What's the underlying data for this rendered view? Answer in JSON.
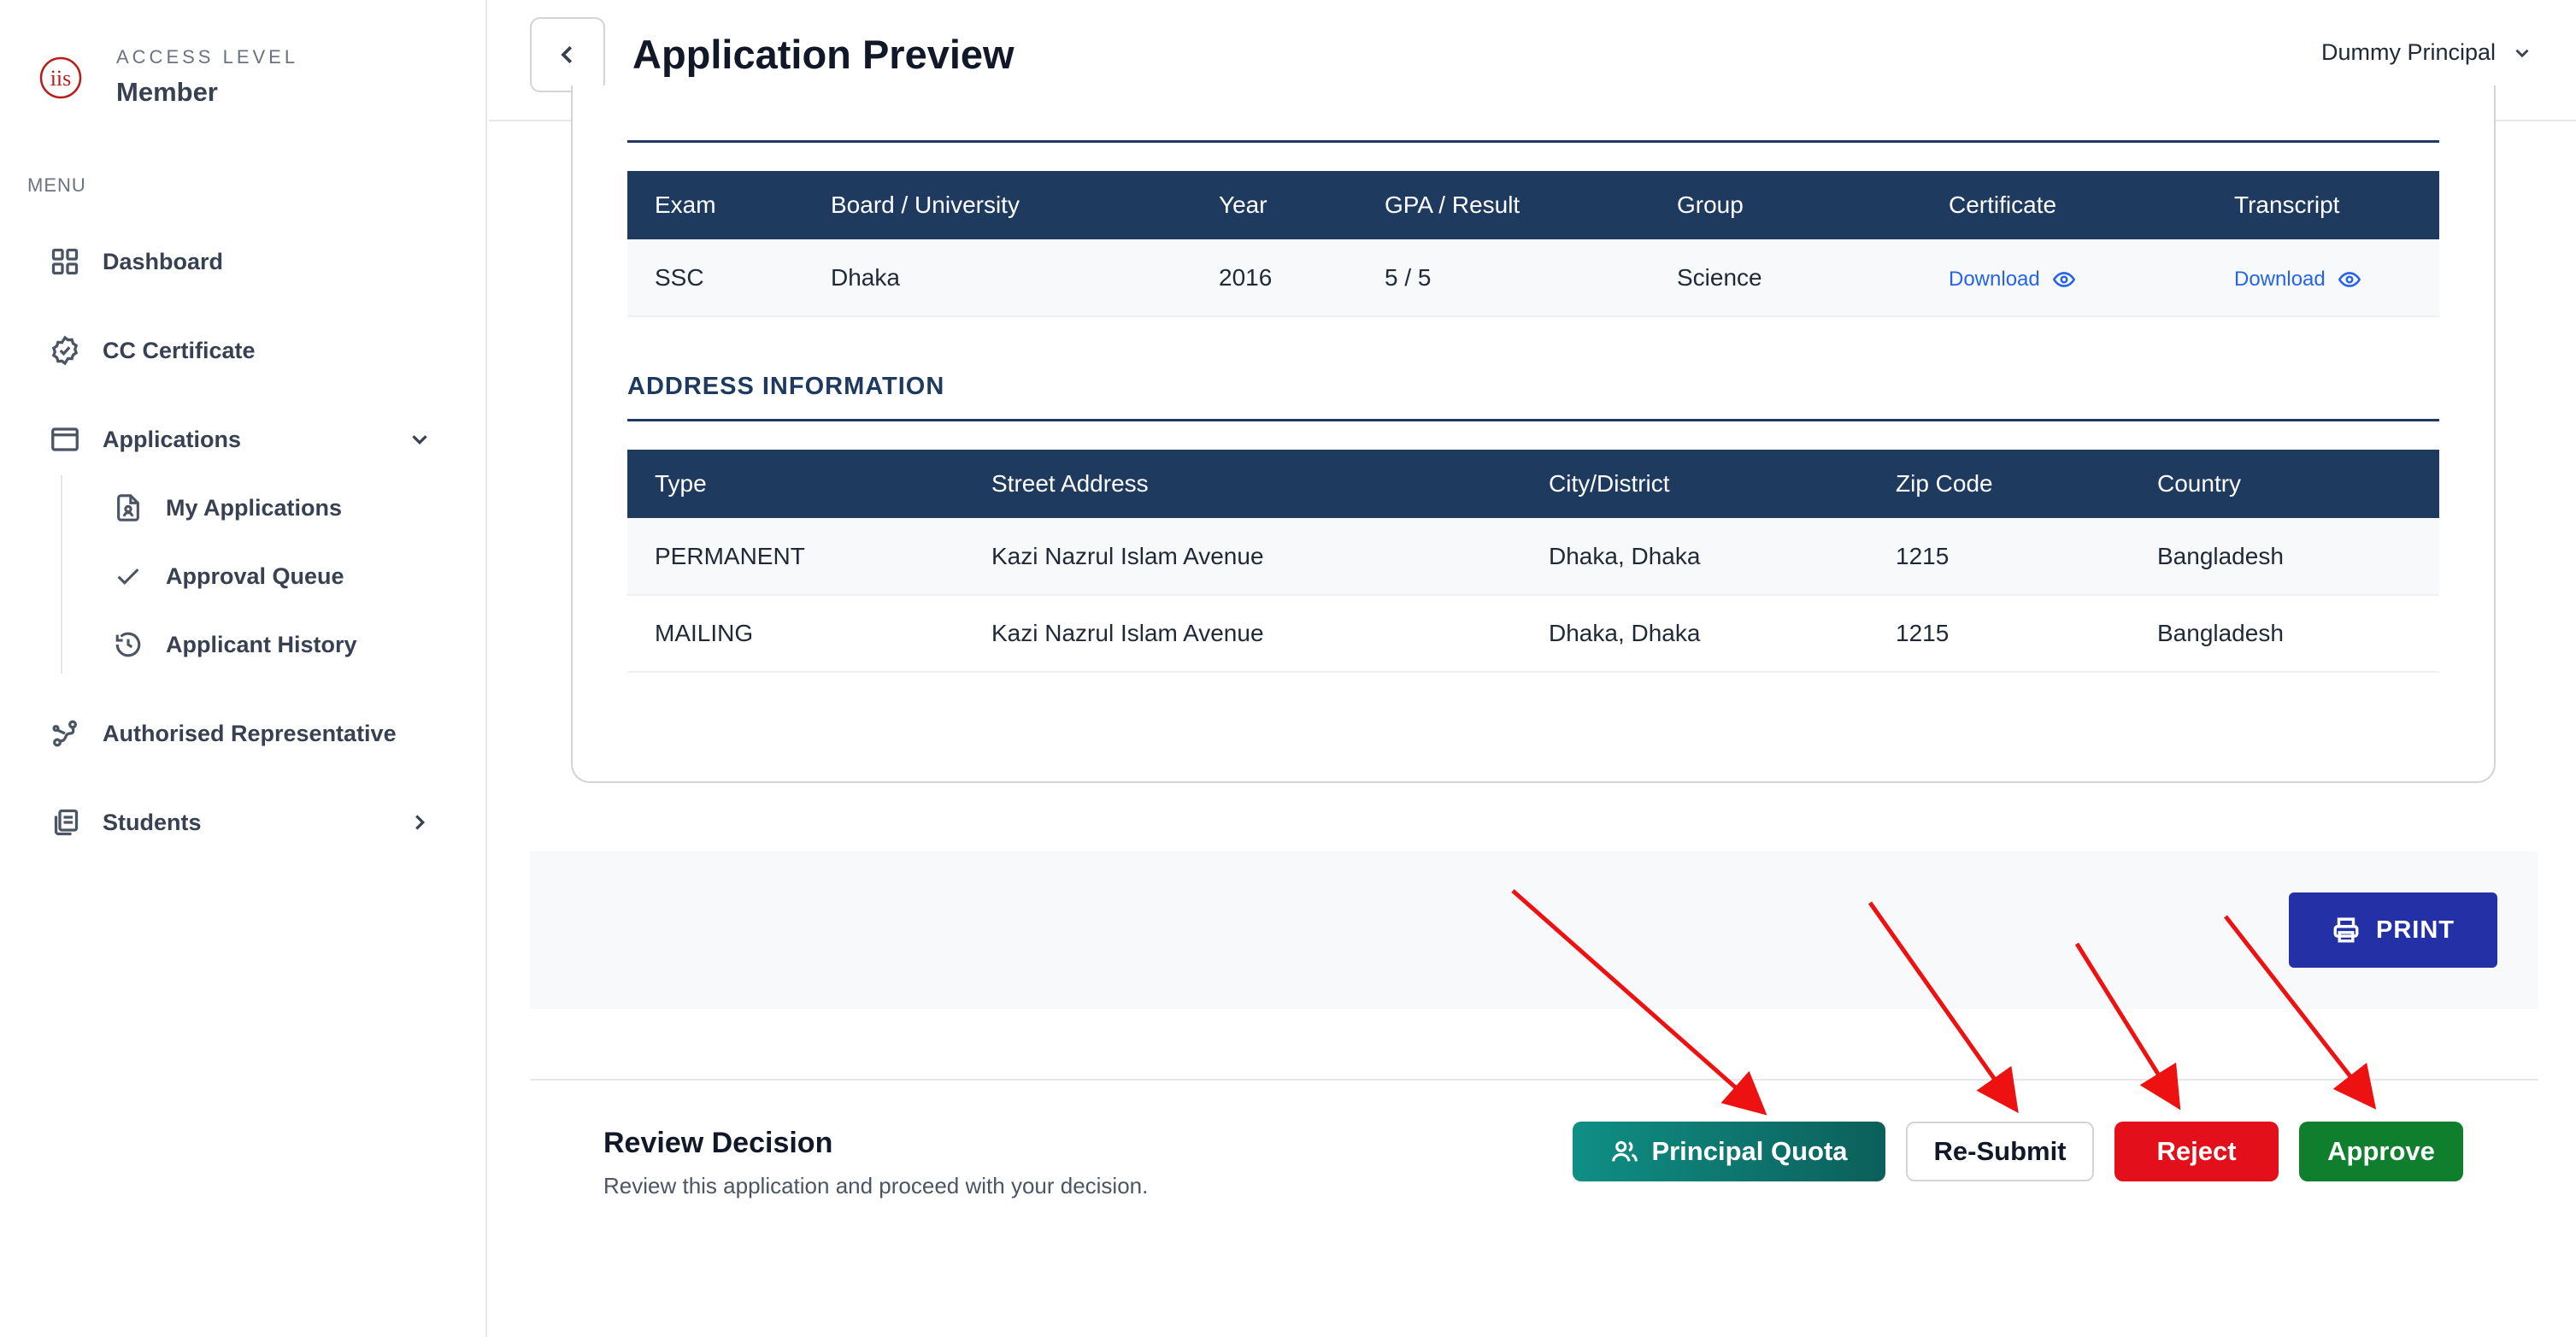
{
  "sidebar": {
    "access_label": "ACCESS LEVEL",
    "access_value": "Member",
    "menu_label": "MENU",
    "items": {
      "dashboard": "Dashboard",
      "cc_certificate": "CC Certificate",
      "applications": "Applications",
      "my_applications": "My Applications",
      "approval_queue": "Approval Queue",
      "applicant_history": "Applicant History",
      "authorised_representative": "Authorised Representative",
      "students": "Students"
    }
  },
  "header": {
    "title": "Application Preview",
    "user": "Dummy Principal"
  },
  "education": {
    "headers": [
      "Exam",
      "Board / University",
      "Year",
      "GPA / Result",
      "Group",
      "Certificate",
      "Transcript"
    ],
    "rows": [
      {
        "exam": "SSC",
        "board": "Dhaka",
        "year": "2016",
        "gpa": "5 / 5",
        "group": "Science",
        "certificate": "Download",
        "transcript": "Download"
      }
    ]
  },
  "address": {
    "title": "ADDRESS INFORMATION",
    "headers": [
      "Type",
      "Street Address",
      "City/District",
      "Zip Code",
      "Country"
    ],
    "rows": [
      {
        "type": "PERMANENT",
        "street": "Kazi Nazrul Islam Avenue",
        "city": "Dhaka, Dhaka",
        "zip": "1215",
        "country": "Bangladesh"
      },
      {
        "type": "MAILING",
        "street": "Kazi Nazrul Islam Avenue",
        "city": "Dhaka, Dhaka",
        "zip": "1215",
        "country": "Bangladesh"
      }
    ]
  },
  "print_label": "PRINT",
  "review": {
    "title": "Review Decision",
    "subtitle": "Review this application and proceed with your decision.",
    "buttons": {
      "principal_quota": "Principal Quota",
      "resubmit": "Re-Submit",
      "reject": "Reject",
      "approve": "Approve"
    }
  },
  "colors": {
    "navy": "#1e3a5f",
    "print": "#2330a6",
    "quota": "#0f8f85",
    "reject": "#e3101b",
    "approve": "#0f7f2e",
    "annotation_arrow": "#ee1111"
  }
}
